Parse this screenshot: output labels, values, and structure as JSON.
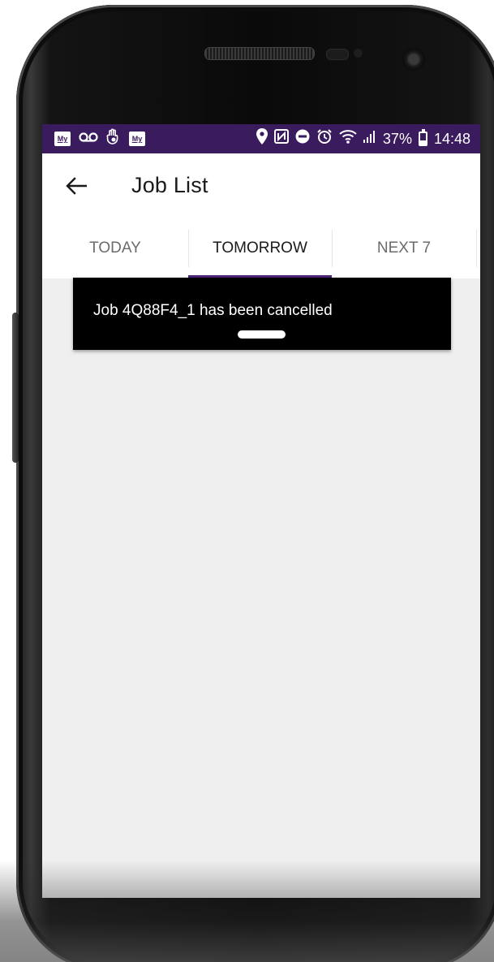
{
  "status_bar": {
    "left_icons": [
      "my-badge-icon",
      "voicemail-icon",
      "hand-icon",
      "my-badge-icon"
    ],
    "my_badge_text": "My",
    "right_icons": [
      "location-pin-icon",
      "nfc-icon",
      "do-not-disturb-icon",
      "alarm-icon",
      "wifi-icon",
      "signal-icon"
    ],
    "battery_percent": "37%",
    "battery_level": 0.37,
    "time": "14:48"
  },
  "app_bar": {
    "title": "Job List",
    "back_icon": "arrow-left-icon"
  },
  "tabs": [
    {
      "label": "TODAY",
      "active": false
    },
    {
      "label": "TOMORROW",
      "active": true
    },
    {
      "label": "NEXT 7",
      "active": false
    }
  ],
  "snackbar": {
    "message": "Job 4Q88F4_1 has been cancelled"
  },
  "colors": {
    "status_bar": "#3a1b5e",
    "tab_indicator": "#4a2475",
    "snackbar_bg": "#000000",
    "content_bg": "#efefef"
  }
}
